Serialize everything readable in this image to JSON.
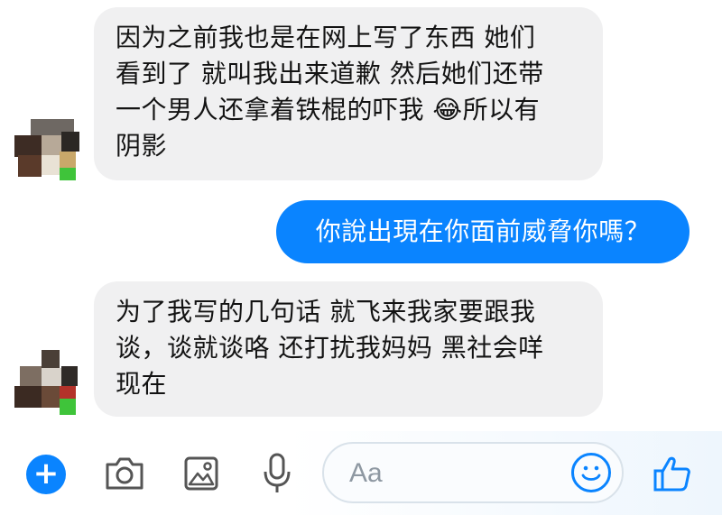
{
  "messages": [
    {
      "direction": "incoming",
      "text": "因为之前我也是在网上写了东西 她们\n看到了 就叫我出来道歉 然后她们还带\n一个男人还拿着铁棍的吓我 😂所以有\n阴影"
    },
    {
      "direction": "outgoing",
      "text": "你說出現在你面前威脅你嗎？"
    },
    {
      "direction": "incoming",
      "text": "为了我写的几句话 就飞来我家要跟我\n谈，谈就谈咯 还打扰我妈妈 黑社会咩\n现在"
    }
  ],
  "composer": {
    "placeholder": "Aa",
    "icons": [
      "plus-icon",
      "camera-icon",
      "gallery-icon",
      "microphone-icon",
      "emoji-icon",
      "thumbs-up-icon"
    ]
  },
  "colors": {
    "accent": "#0a84ff",
    "incoming_bubble": "#f0f0f1",
    "outgoing_bubble": "#0a84ff"
  }
}
